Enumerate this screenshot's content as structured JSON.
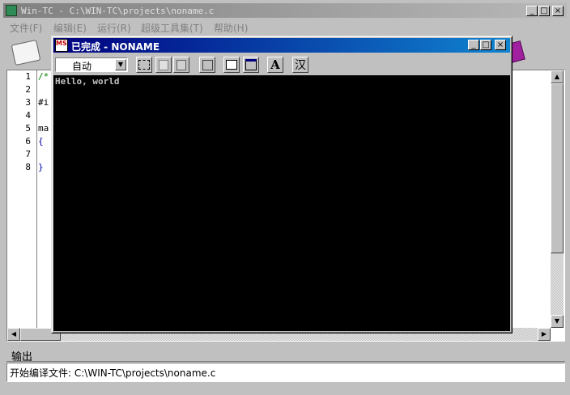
{
  "main_window": {
    "title": "Win-TC - C:\\WIN-TC\\projects\\noname.c",
    "controls": [
      "_",
      "□",
      "×"
    ]
  },
  "menu": [
    "文件(F)",
    "编辑(E)",
    "运行(R)",
    "超级工具集(T)",
    "帮助(H)"
  ],
  "editor": {
    "line_numbers": [
      "1",
      "2",
      "3",
      "4",
      "5",
      "6",
      "7",
      "8"
    ],
    "code_lines": [
      "/*",
      "",
      "#i",
      "",
      "ma",
      "{",
      "",
      "}"
    ]
  },
  "console": {
    "icon_text": "MS",
    "title": "已完成 - NONAME",
    "controls": [
      "_",
      "□",
      "×"
    ],
    "font_select": "自动",
    "font_button": "A",
    "han_button": "汉",
    "output": "Hello, world"
  },
  "output_panel": {
    "label": "输出",
    "message": "开始编译文件: C:\\WIN-TC\\projects\\noname.c"
  },
  "colors": {
    "face": "#c0c0c0",
    "active_title_start": "#000080",
    "active_title_end": "#1084d0",
    "inactive_title_start": "#808080",
    "inactive_title_end": "#b8b8b8",
    "console_bg": "#000000",
    "console_text": "#c0c0c0"
  }
}
